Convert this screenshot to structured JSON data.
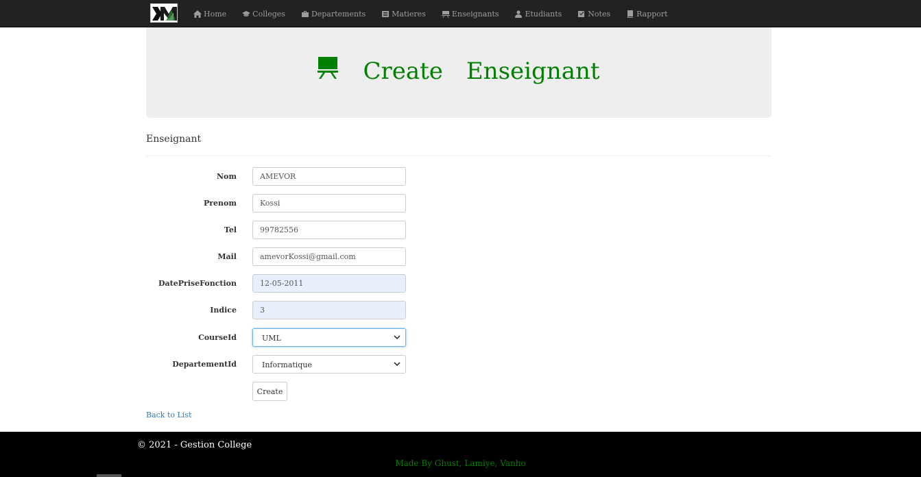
{
  "nav": {
    "logo_alt": "M",
    "items": [
      {
        "label": "Home",
        "icon": "home-icon"
      },
      {
        "label": "Colleges",
        "icon": "graduation-cap-icon"
      },
      {
        "label": "Departements",
        "icon": "briefcase-icon"
      },
      {
        "label": "Matieres",
        "icon": "list-icon"
      },
      {
        "label": "Enseignants",
        "icon": "blackboard-icon"
      },
      {
        "label": "Etudiants",
        "icon": "user-icon"
      },
      {
        "label": "Notes",
        "icon": "check-square-icon"
      },
      {
        "label": "Rapport",
        "icon": "book-icon"
      }
    ]
  },
  "header": {
    "title_word1": "Create",
    "title_word2": "Enseignant",
    "icon": "blackboard-icon",
    "accent_color": "#008000"
  },
  "form": {
    "section_title": "Enseignant",
    "fields": {
      "nom": {
        "label": "Nom",
        "value": "AMEVOR"
      },
      "prenom": {
        "label": "Prenom",
        "value": "Kossi"
      },
      "tel": {
        "label": "Tel",
        "value": "99782556"
      },
      "mail": {
        "label": "Mail",
        "value": "amevorKossi@gmail.com"
      },
      "date": {
        "label": "DatePriseFonction",
        "value": "12-05-2011"
      },
      "indice": {
        "label": "Indice",
        "value": "3"
      },
      "course": {
        "label": "CourseId",
        "value": "UML"
      },
      "departement": {
        "label": "DepartementId",
        "value": "Informatique"
      }
    },
    "submit_label": "Create",
    "back_link": "Back to List"
  },
  "footer": {
    "copyright": "© 2021 - Gestion College",
    "credits": "Made By Ghust, Lamiye, Vanho"
  }
}
